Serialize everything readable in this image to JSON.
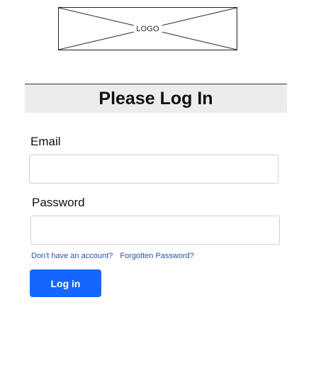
{
  "logo": {
    "text": "LOGO"
  },
  "form": {
    "title": "Please Log In",
    "email_label": "Email",
    "email_value": "",
    "password_label": "Password",
    "password_value": "",
    "signup_link": "Don't have an account?",
    "forgot_link": "Forgotten Password?",
    "login_button": "Log in"
  },
  "colors": {
    "accent": "#1466ff",
    "link": "#2b4fb5",
    "title_bar_background": "#ececec"
  }
}
